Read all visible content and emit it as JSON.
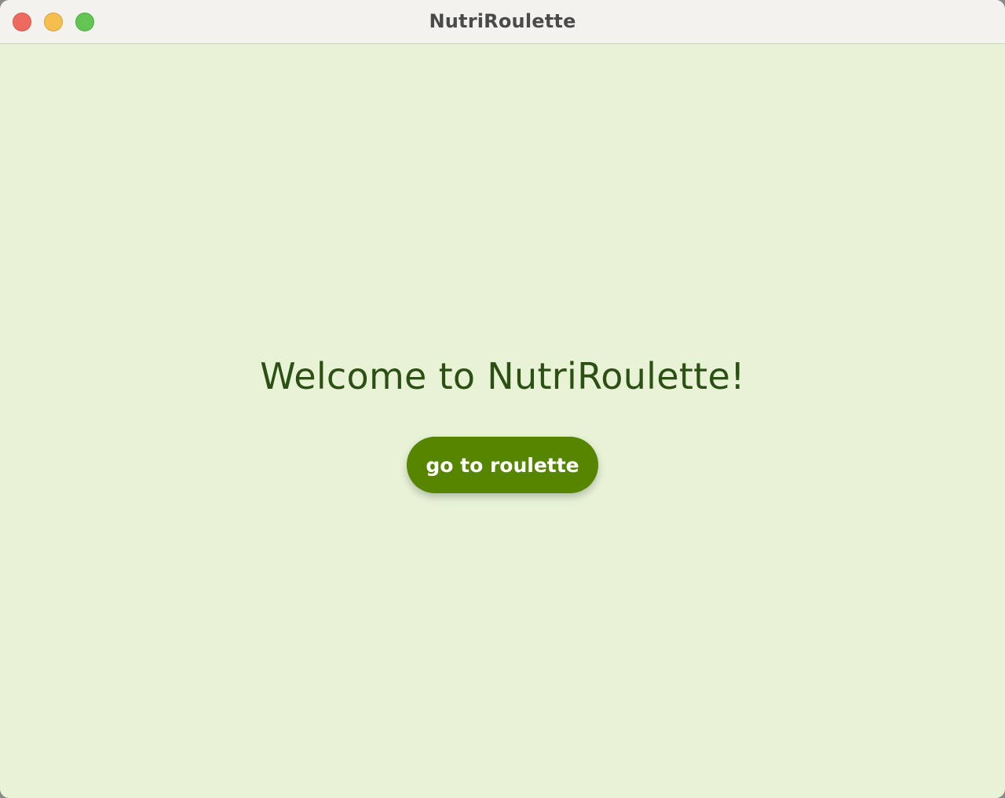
{
  "window": {
    "title": "NutriRoulette",
    "controls": [
      "close",
      "minimize",
      "zoom"
    ]
  },
  "main": {
    "welcome_text": "Welcome to NutriRoulette!",
    "button_label": "go to roulette"
  },
  "colors": {
    "background": "#e8f3d6",
    "heading": "#2c5014",
    "button": "#568500",
    "button_text": "#ffffff",
    "close": "#ee6a5f",
    "minimize": "#f5be4f",
    "zoom": "#62c554"
  }
}
